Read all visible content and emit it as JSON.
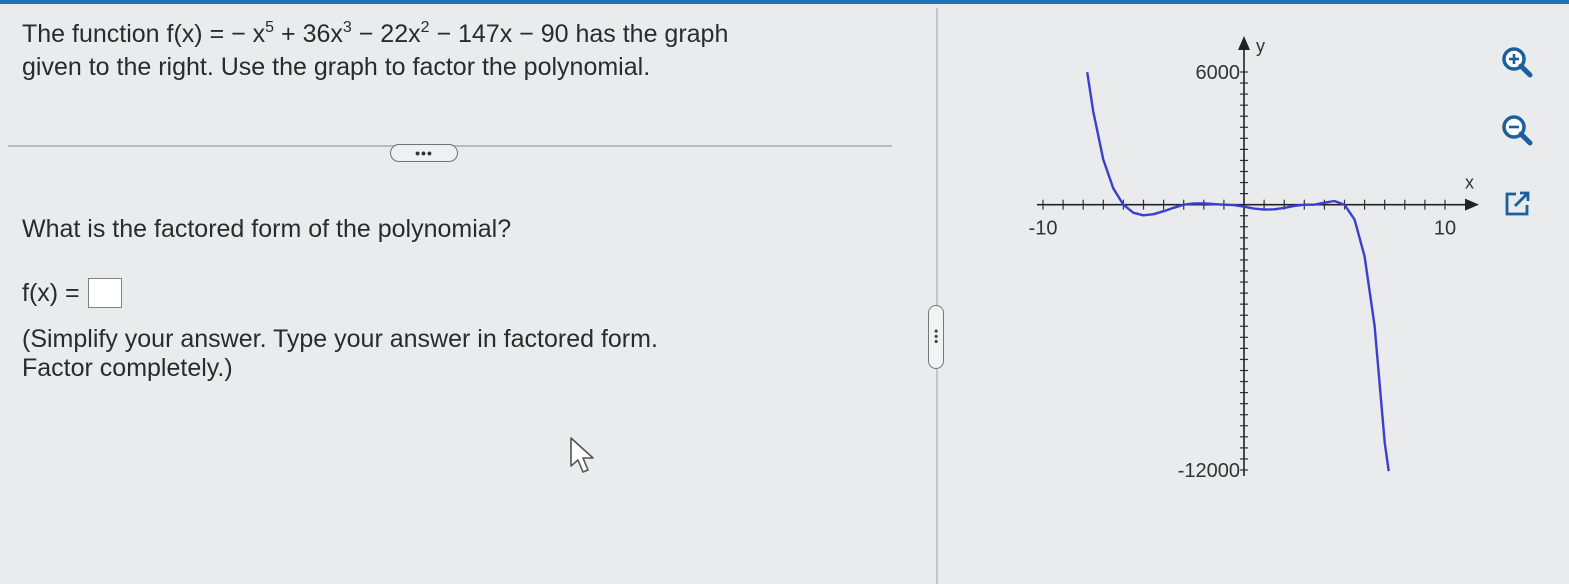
{
  "problem": {
    "intro": "The function f(x) = − x",
    "exp1": "5",
    "term2": " + 36x",
    "exp2": "3",
    "term3": " − 22x",
    "exp3": "2",
    "term4": " − 147x − 90 has the graph",
    "line2": "given to the right. Use the graph to factor the polynomial."
  },
  "more_button": "•••",
  "question": "What is the factored form of the polynomial?",
  "answer": {
    "label": "f(x) =",
    "value": ""
  },
  "instructions": {
    "line1": "(Simplify your answer. Type your answer in factored form.",
    "line2": "Factor completely.)"
  },
  "splitter": "•••",
  "chart_data": {
    "type": "line",
    "function": "f(x) = -x^5 + 36x^3 - 22x^2 - 147x - 90",
    "xlabel": "x",
    "ylabel": "y",
    "xlim": [
      -10,
      10
    ],
    "ylim": [
      -12000,
      6000
    ],
    "x_tick_labels": [
      "-10",
      "10"
    ],
    "y_tick_labels": [
      "6000",
      "-12000"
    ],
    "x_tick_step": 1,
    "y_tick_step": 500,
    "series": [
      {
        "color": "#3a3fd0",
        "x": [
          -7.8,
          -7.5,
          -7.0,
          -6.5,
          -6.0,
          -5.5,
          -5.0,
          -4.5,
          -4.0,
          -3.5,
          -3.0,
          -2.5,
          -2.0,
          -1.5,
          -1.0,
          -0.5,
          0,
          0.5,
          1.0,
          1.5,
          2.0,
          2.5,
          3.0,
          3.5,
          4.0,
          4.5,
          5.0,
          5.5,
          6.0,
          6.5,
          7.0,
          7.2
        ],
        "y": [
          5990,
          4206,
          2040,
          735,
          0,
          -368,
          -480,
          -431,
          -294,
          -140,
          0,
          58,
          60,
          26,
          0,
          -18,
          -90,
          -177,
          -224,
          -209,
          -144,
          -54,
          0,
          0,
          90,
          166,
          0,
          -682,
          -2340,
          -5481,
          -10752,
          -12050
        ]
      }
    ]
  },
  "tools": {
    "zoom_in": "zoom-in-icon",
    "zoom_out": "zoom-out-icon",
    "popout": "external-link-icon"
  },
  "colors": {
    "curve": "#3a3fd0",
    "accent": "#1f73b7",
    "background": "#e9ebec"
  }
}
